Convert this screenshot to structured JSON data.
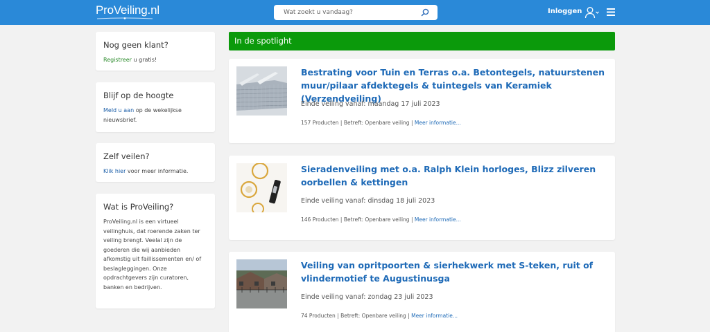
{
  "header": {
    "logo": "ProVeiling.nl",
    "search_placeholder": "Wat zoekt u vandaag?",
    "login_label": "Inloggen",
    "icons": [
      "search-icon",
      "user-icon",
      "chevron-down-icon",
      "menu-icon"
    ],
    "bar_color": "#2a89d8"
  },
  "sidebar": {
    "cards": [
      {
        "title": "Nog geen klant?",
        "link": "Registreer",
        "text": " u gratis!"
      },
      {
        "title": "Blijf op de hoogte",
        "link": "Meld u aan",
        "text": " op de wekelijkse nieuwsbrief."
      },
      {
        "title": "Zelf veilen?",
        "link": "Klik hier",
        "text": " voor meer informatie."
      },
      {
        "title": "Wat is ProVeiling?",
        "body": "ProVeiling.nl is een virtueel veilinghuis, dat roerende zaken ter veiling brengt. Veelal zijn de goederen die wij aanbieden afkomstig uit faillissementen en/ of beslagleggingen. Onze opdrachtgevers zijn curatoren, banken en bedrijven."
      }
    ]
  },
  "spotlight": {
    "heading": "In de spotlight",
    "color": "#0b9a0b",
    "auctions": [
      {
        "title": "Bestrating voor Tuin en Terras o.a. Betontegels, natuurstenen muur/pilaar afdektegels & tuintegels van Keramiek (Verzendveiling)",
        "date": "Einde veiling vanaf: maandag 17 juli 2023",
        "products": "157 Producten",
        "type": "Betreft: Openbare veiling",
        "more": "Meer informatie..."
      },
      {
        "title": "Sieradenveiling met o.a. Ralph Klein horloges, Blizz zilveren oorbellen & kettingen",
        "date": "Einde veiling vanaf: dinsdag 18 juli 2023",
        "products": "146 Producten",
        "type": "Betreft: Openbare veiling",
        "more": "Meer informatie..."
      },
      {
        "title": "Veiling van opritpoorten & sierhekwerk met S-teken, ruit of vlindermotief te Augustinusga",
        "date": "Einde veiling vanaf: zondag 23 juli 2023",
        "products": "74 Producten",
        "type": "Betreft: Openbare veiling",
        "more": "Meer informatie..."
      }
    ]
  }
}
